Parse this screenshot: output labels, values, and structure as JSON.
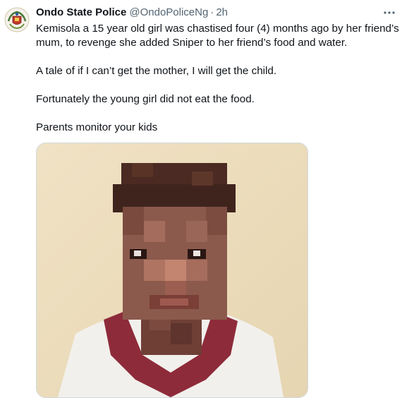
{
  "tweet": {
    "author_name": "Ondo State Police",
    "handle": "@OndoPoliceNg",
    "separator": "·",
    "time": "2h",
    "paragraphs": [
      "Kemisola a 15 year old girl was chastised four (4) months ago by her friend’s mum, to revenge she added Sniper to her friend’s food and water.",
      "A tale of if I can’t get the mother, I will get the child.",
      "Fortunately the young girl did not eat the food.",
      "Parents monitor your kids"
    ]
  },
  "icons": {
    "avatar": "police-crest-icon",
    "more": "more-options-icon"
  },
  "colors": {
    "text": "#0f1419",
    "secondary": "#536471",
    "border": "#cfd9de"
  }
}
